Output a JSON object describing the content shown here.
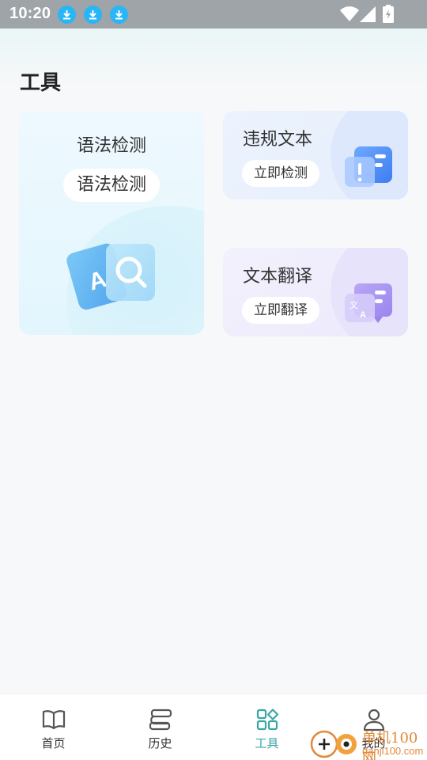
{
  "status_bar": {
    "time": "10:20",
    "notifications": [
      "download-icon",
      "download-icon",
      "download-icon"
    ],
    "system_icons": [
      "wifi-icon",
      "signal-icon",
      "battery-charging-icon"
    ]
  },
  "page": {
    "title": "工具"
  },
  "tools": {
    "grammar": {
      "title": "语法检测",
      "button": "语法检测",
      "icon": "grammar-search-icon"
    },
    "violation": {
      "title": "违规文本",
      "button": "立即检测",
      "icon": "warning-document-icon"
    },
    "translate": {
      "title": "文本翻译",
      "button": "立即翻译",
      "icon": "translate-document-icon"
    }
  },
  "bottom_nav": {
    "items": [
      {
        "label": "首页",
        "icon": "book-icon",
        "active": false
      },
      {
        "label": "历史",
        "icon": "history-icon",
        "active": false
      },
      {
        "label": "工具",
        "icon": "tools-grid-icon",
        "active": true
      },
      {
        "label": "我的",
        "icon": "user-icon",
        "active": false
      }
    ]
  },
  "watermark": {
    "line1": "单机100网",
    "line2": "danji100.com"
  },
  "colors": {
    "accent": "#3aa6a6",
    "status_bar": "#9ea4a8",
    "download_badge": "#29b6f6",
    "watermark": "#e08a3a"
  }
}
